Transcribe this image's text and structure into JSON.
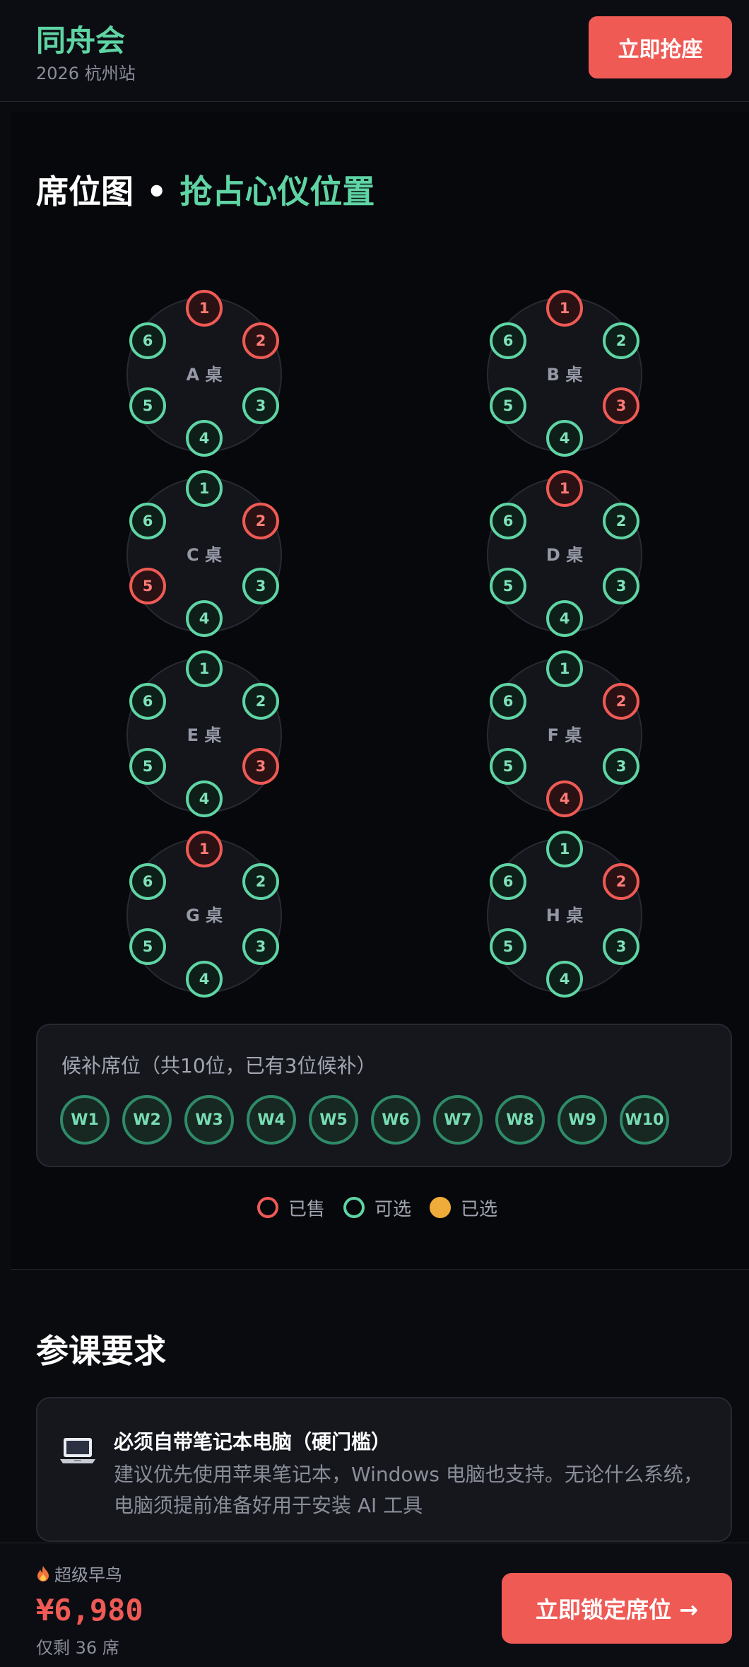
{
  "header": {
    "brand": "同舟会",
    "subtitle": "2026 杭州站",
    "cta": "立即抢座"
  },
  "seat_map": {
    "title_main": "席位图",
    "title_dot": "•",
    "title_accent": "抢占心仪位置",
    "tables": [
      {
        "label": "A 桌",
        "seats": [
          {
            "n": "1",
            "status": "sold"
          },
          {
            "n": "2",
            "status": "sold"
          },
          {
            "n": "3",
            "status": "available"
          },
          {
            "n": "4",
            "status": "available"
          },
          {
            "n": "5",
            "status": "available"
          },
          {
            "n": "6",
            "status": "available"
          }
        ]
      },
      {
        "label": "B 桌",
        "seats": [
          {
            "n": "1",
            "status": "sold"
          },
          {
            "n": "2",
            "status": "available"
          },
          {
            "n": "3",
            "status": "sold"
          },
          {
            "n": "4",
            "status": "available"
          },
          {
            "n": "5",
            "status": "available"
          },
          {
            "n": "6",
            "status": "available"
          }
        ]
      },
      {
        "label": "C 桌",
        "seats": [
          {
            "n": "1",
            "status": "available"
          },
          {
            "n": "2",
            "status": "sold"
          },
          {
            "n": "3",
            "status": "available"
          },
          {
            "n": "4",
            "status": "available"
          },
          {
            "n": "5",
            "status": "sold"
          },
          {
            "n": "6",
            "status": "available"
          }
        ]
      },
      {
        "label": "D 桌",
        "seats": [
          {
            "n": "1",
            "status": "sold"
          },
          {
            "n": "2",
            "status": "available"
          },
          {
            "n": "3",
            "status": "available"
          },
          {
            "n": "4",
            "status": "available"
          },
          {
            "n": "5",
            "status": "available"
          },
          {
            "n": "6",
            "status": "available"
          }
        ]
      },
      {
        "label": "E 桌",
        "seats": [
          {
            "n": "1",
            "status": "available"
          },
          {
            "n": "2",
            "status": "available"
          },
          {
            "n": "3",
            "status": "sold"
          },
          {
            "n": "4",
            "status": "available"
          },
          {
            "n": "5",
            "status": "available"
          },
          {
            "n": "6",
            "status": "available"
          }
        ]
      },
      {
        "label": "F 桌",
        "seats": [
          {
            "n": "1",
            "status": "available"
          },
          {
            "n": "2",
            "status": "sold"
          },
          {
            "n": "3",
            "status": "available"
          },
          {
            "n": "4",
            "status": "sold"
          },
          {
            "n": "5",
            "status": "available"
          },
          {
            "n": "6",
            "status": "available"
          }
        ]
      },
      {
        "label": "G 桌",
        "seats": [
          {
            "n": "1",
            "status": "sold"
          },
          {
            "n": "2",
            "status": "available"
          },
          {
            "n": "3",
            "status": "available"
          },
          {
            "n": "4",
            "status": "available"
          },
          {
            "n": "5",
            "status": "available"
          },
          {
            "n": "6",
            "status": "available"
          }
        ]
      },
      {
        "label": "H 桌",
        "seats": [
          {
            "n": "1",
            "status": "available"
          },
          {
            "n": "2",
            "status": "sold"
          },
          {
            "n": "3",
            "status": "available"
          },
          {
            "n": "4",
            "status": "available"
          },
          {
            "n": "5",
            "status": "available"
          },
          {
            "n": "6",
            "status": "available"
          }
        ]
      }
    ],
    "waitlist": {
      "title": "候补席位（共10位，已有3位候补）",
      "seats": [
        "W1",
        "W2",
        "W3",
        "W4",
        "W5",
        "W6",
        "W7",
        "W8",
        "W9",
        "W10"
      ]
    },
    "legend": {
      "sold": "已售",
      "available": "可选",
      "selected": "已选"
    }
  },
  "requirements": {
    "title": "参课要求",
    "card_icon": "laptop-icon",
    "card_title": "必须自带笔记本电脑（硬门槛）",
    "card_text": "建议优先使用苹果笔记本，Windows 电脑也支持。无论什么系统，电脑须提前准备好用于安装 AI 工具"
  },
  "footer": {
    "tag_icon": "fire-icon",
    "tag": "超级早鸟",
    "price": "¥6,980",
    "remaining": "仅剩 36 席",
    "cta": "立即锁定席位 →"
  },
  "colors": {
    "accent": "#5fd4a4",
    "sold": "#ef5a55",
    "selected": "#efac3a",
    "background": "#0a0b0f"
  }
}
